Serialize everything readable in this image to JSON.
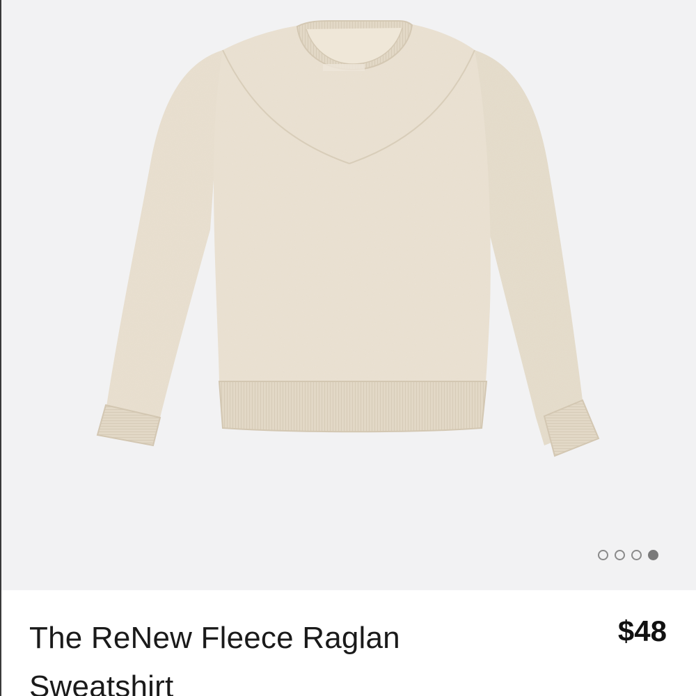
{
  "product": {
    "name": "The ReNew Fleece Raglan Sweatshirt",
    "price": "$48",
    "image_subject": "sweatshirt-image",
    "colors": {
      "garment": "#e8dfcf",
      "garment_shadow": "#d9cfbd",
      "ribbing": "#e2d8c6",
      "background": "#f2f2f3"
    }
  },
  "carousel": {
    "total": 4,
    "active_index": 3
  }
}
